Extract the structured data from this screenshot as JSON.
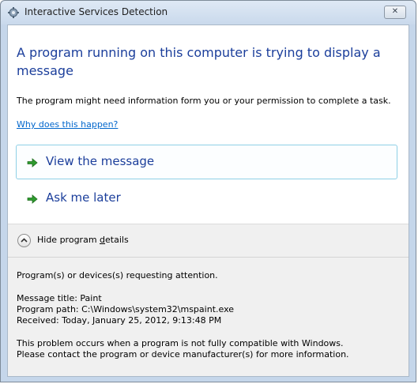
{
  "window": {
    "title": "Interactive Services Detection",
    "close_glyph": "✕"
  },
  "main": {
    "heading": "A program running on this computer is trying to display a message",
    "description": "The program might need information form you or your permission to complete a task.",
    "why_link": "Why does this happen?"
  },
  "commands": {
    "view_message": "View the message",
    "ask_later": "Ask me later",
    "arrow_icon": "green-arrow-icon"
  },
  "details": {
    "toggle_label_pre": "Hide program ",
    "toggle_label_accel": "d",
    "toggle_label_post": "etails",
    "requesting": "Program(s) or devices(s) requesting attention.",
    "message_title": "Message title: Paint",
    "program_path": "Program path:  C:\\Windows\\system32\\mspaint.exe",
    "received": "Received:  Today, January 25, 2012, 9:13:48 PM",
    "problem_line1": "This problem occurs when a program is not fully compatible with Windows.",
    "problem_line2": "Please contact the program or device manufacturer(s) for more information."
  },
  "colors": {
    "accent": "#1b3e9b",
    "link": "#0066cc",
    "arrow_green": "#2e9b2e"
  }
}
